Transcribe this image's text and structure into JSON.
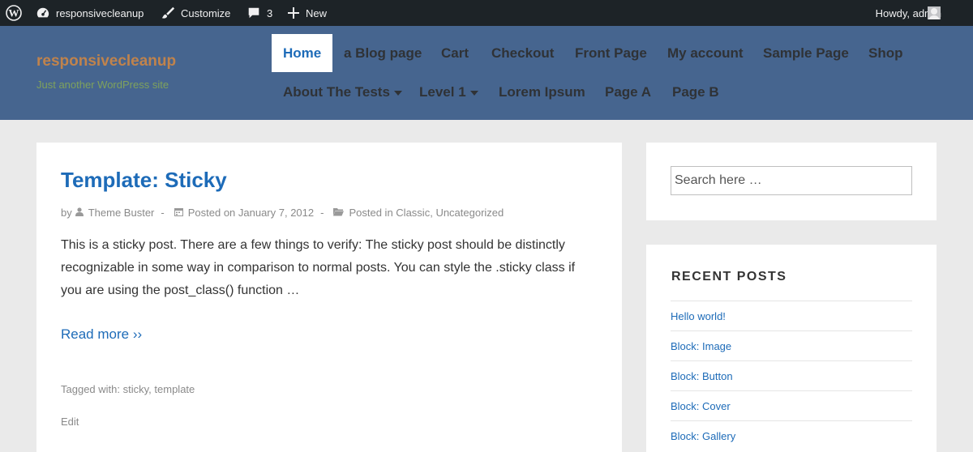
{
  "adminbar": {
    "site_name": "responsivecleanup",
    "customize": "Customize",
    "comments_count": "3",
    "new_label": "New",
    "howdy": "Howdy, admin"
  },
  "header": {
    "site_title": "responsivecleanup",
    "tagline": "Just another WordPress site",
    "nav": [
      {
        "label": "Home",
        "active": true
      },
      {
        "label": "a Blog page"
      },
      {
        "label": "Cart"
      },
      {
        "label": "Checkout"
      },
      {
        "label": "Front Page"
      },
      {
        "label": "My account"
      },
      {
        "label": "Sample Page"
      },
      {
        "label": "Shop"
      },
      {
        "label": "About The Tests",
        "has_submenu": true
      },
      {
        "label": "Level 1",
        "has_submenu": true
      },
      {
        "label": "Lorem Ipsum"
      },
      {
        "label": "Page A"
      },
      {
        "label": "Page B"
      }
    ]
  },
  "post": {
    "title": "Template: Sticky",
    "by": "by",
    "author": "Theme Buster",
    "posted_on": "Posted on January 7, 2012",
    "posted_in": "Posted in",
    "categories": [
      "Classic",
      "Uncategorized"
    ],
    "excerpt": "This is a sticky post. There are a few things to verify: The sticky post should be distinctly recognizable in some way in comparison to normal posts. You can style the .sticky class if you are using the post_class() function …",
    "read_more": "Read more ››",
    "tagged_with": "Tagged with:",
    "tags": [
      "sticky",
      "template"
    ],
    "edit": "Edit"
  },
  "sidebar": {
    "search_placeholder": "Search here …",
    "recent_posts_title": "RECENT POSTS",
    "recent_posts": [
      "Hello world!",
      "Block: Image",
      "Block: Button",
      "Block: Cover",
      "Block: Gallery"
    ]
  },
  "colors": {
    "adminbar_bg": "#1d2327",
    "header_bg": "#46658f",
    "link": "#1d6bb8",
    "site_title": "#c0834c",
    "tagline": "#7fa25c"
  }
}
